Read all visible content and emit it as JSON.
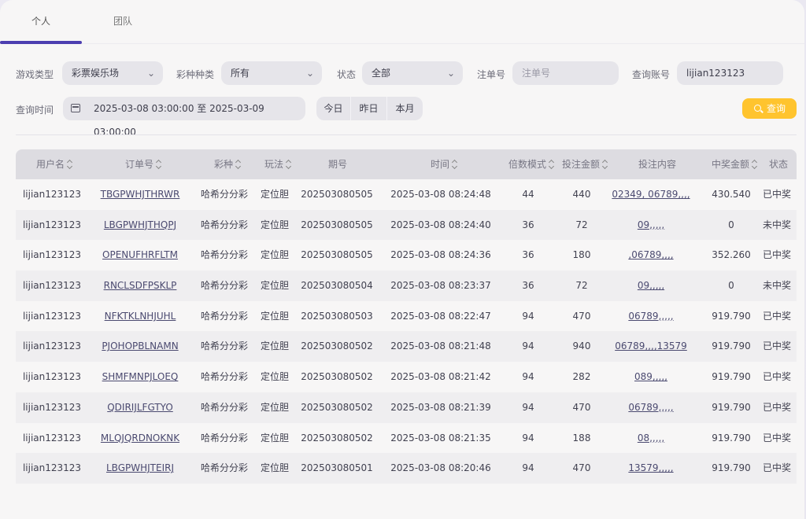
{
  "tabs": [
    "个人",
    "团队"
  ],
  "filters": {
    "game_type_label": "游戏类型",
    "game_type_value": "彩票娱乐场",
    "lottery_kind_label": "彩种种类",
    "lottery_kind_value": "所有",
    "status_label": "状态",
    "status_value": "全部",
    "order_no_label": "注单号",
    "order_no_placeholder": "注单号",
    "account_label": "查询账号",
    "account_value": "lijian123123",
    "time_label": "查询时间",
    "time_range": "2025-03-08 03:00:00 至 2025-03-09 03:00:00",
    "quick_today": "今日",
    "quick_yesterday": "昨日",
    "quick_month": "本月",
    "search_label": "查询"
  },
  "table": {
    "headers": [
      "用户名",
      "订单号",
      "彩种",
      "玩法",
      "期号",
      "时间",
      "倍数模式",
      "投注金额",
      "投注内容",
      "中奖金额",
      "状态"
    ],
    "rows": [
      [
        "lijian123123",
        "TBGPWHJTHRWR",
        "哈希分分彩",
        "定位胆",
        "202503080505",
        "2025-03-08 08:24:48",
        "44",
        "440",
        "02349, 06789,,,,",
        "430.540",
        "已中奖"
      ],
      [
        "lijian123123",
        "LBGPWHJTHQPJ",
        "哈希分分彩",
        "定位胆",
        "202503080505",
        "2025-03-08 08:24:40",
        "36",
        "72",
        "09,,,,,",
        "0",
        "未中奖"
      ],
      [
        "lijian123123",
        "OPENUFHRFLTM",
        "哈希分分彩",
        "定位胆",
        "202503080505",
        "2025-03-08 08:24:36",
        "36",
        "180",
        ",06789,,,,",
        "352.260",
        "已中奖"
      ],
      [
        "lijian123123",
        "RNCLSDFPSKLP",
        "哈希分分彩",
        "定位胆",
        "202503080504",
        "2025-03-08 08:23:37",
        "36",
        "72",
        "09,,,,,",
        "0",
        "未中奖"
      ],
      [
        "lijian123123",
        "NFKTKLNHJUHL",
        "哈希分分彩",
        "定位胆",
        "202503080503",
        "2025-03-08 08:22:47",
        "94",
        "470",
        "06789,,,,,",
        "919.790",
        "已中奖"
      ],
      [
        "lijian123123",
        "PJOHOPBLNAMN",
        "哈希分分彩",
        "定位胆",
        "202503080502",
        "2025-03-08 08:21:48",
        "94",
        "940",
        "06789,,,,13579",
        "919.790",
        "已中奖"
      ],
      [
        "lijian123123",
        "SHMFMNPJLOEQ",
        "哈希分分彩",
        "定位胆",
        "202503080502",
        "2025-03-08 08:21:42",
        "94",
        "282",
        "089,,,,,",
        "919.790",
        "已中奖"
      ],
      [
        "lijian123123",
        "QDIRIJLFGTYO",
        "哈希分分彩",
        "定位胆",
        "202503080502",
        "2025-03-08 08:21:39",
        "94",
        "470",
        "06789,,,,,",
        "919.790",
        "已中奖"
      ],
      [
        "lijian123123",
        "MLQJQRDNOKNK",
        "哈希分分彩",
        "定位胆",
        "202503080502",
        "2025-03-08 08:21:35",
        "94",
        "188",
        "08,,,,,",
        "919.790",
        "已中奖"
      ],
      [
        "lijian123123",
        "LBGPWHJTEIRJ",
        "哈希分分彩",
        "定位胆",
        "202503080501",
        "2025-03-08 08:20:46",
        "94",
        "470",
        "13579,,,,,",
        "919.790",
        "已中奖"
      ]
    ]
  },
  "colors": {
    "accent": "#4c3eb0",
    "search_button": "#ffc42e"
  }
}
